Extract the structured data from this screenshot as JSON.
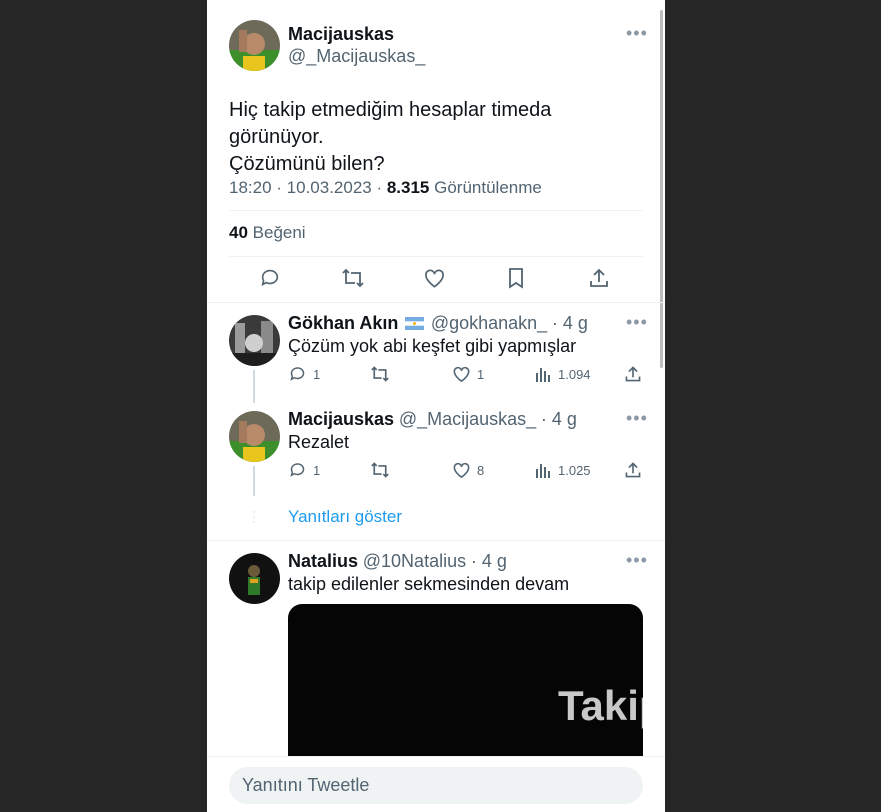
{
  "main_tweet": {
    "author_name": "Macijauskas",
    "author_handle": "@_Macijauskas_",
    "text_line1": "Hiç takip etmediğim hesaplar timeda görünüyor.",
    "text_line2": "Çözümünü bilen?",
    "time": "18:20 · 10.03.2023 · ",
    "views_count": "8.315",
    "views_label": " Görüntülenme",
    "likes_count": "40",
    "likes_label": " Beğeni"
  },
  "replies": [
    {
      "author_name": "Gökhan Akın",
      "author_handle": "@gokhanakn_",
      "age": "· 4 g",
      "text": "Çözüm yok abi keşfet gibi yapmışlar",
      "reply_count": "1",
      "like_count": "1",
      "view_count": "1.094"
    },
    {
      "author_name": "Macijauskas",
      "author_handle": "@_Macijauskas_",
      "age": "· 4 g",
      "text": "Rezalet",
      "reply_count": "1",
      "like_count": "8",
      "view_count": "1.025"
    }
  ],
  "show_replies_label": "Yanıtları göster",
  "third_reply": {
    "author_name": "Natalius",
    "author_handle": "@10Natalius",
    "age": "· 4 g",
    "text": "takip edilenler sekmesinden devam",
    "media_text": "Takip"
  },
  "reply_bar": {
    "placeholder": "Yanıtını Tweetle"
  },
  "colors": {
    "accent": "#1d9bf0",
    "secondary_text": "#536471",
    "background": "#262626"
  },
  "icons": [
    "more-icon",
    "reply-icon",
    "retweet-icon",
    "like-icon",
    "bookmark-icon",
    "share-icon",
    "views-icon",
    "argentina-flag-icon"
  ]
}
